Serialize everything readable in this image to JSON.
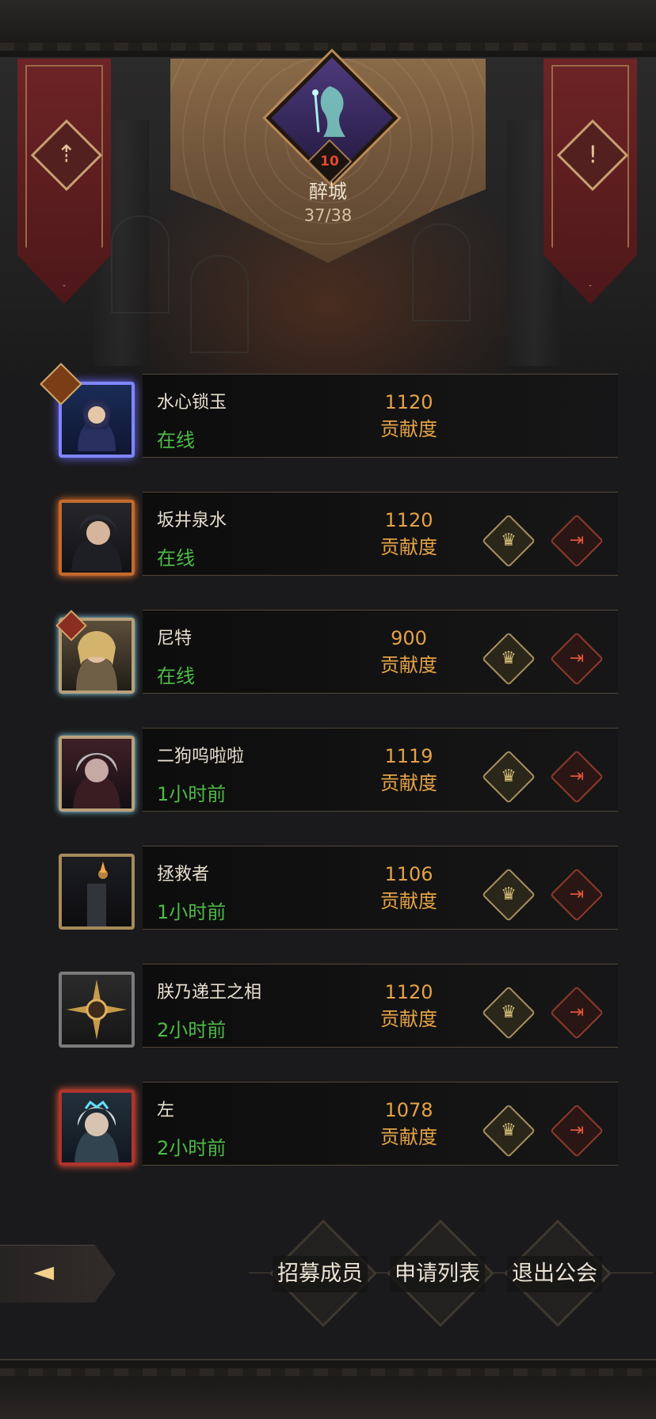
{
  "guild": {
    "level": "10",
    "name": "醉城",
    "members_count": "37/38"
  },
  "members": [
    {
      "name": "水心锁玉",
      "status": "在线",
      "contribution": "1120",
      "contribution_label": "贡献度",
      "can_manage": false
    },
    {
      "name": "坂井泉水",
      "status": "在线",
      "contribution": "1120",
      "contribution_label": "贡献度",
      "can_manage": true
    },
    {
      "name": "尼特",
      "status": "在线",
      "contribution": "900",
      "contribution_label": "贡献度",
      "can_manage": true
    },
    {
      "name": "二狗呜啦啦",
      "status": "1小时前",
      "contribution": "1119",
      "contribution_label": "贡献度",
      "can_manage": true
    },
    {
      "name": "拯救者",
      "status": "1小时前",
      "contribution": "1106",
      "contribution_label": "贡献度",
      "can_manage": true
    },
    {
      "name": "朕乃递王之相",
      "status": "2小时前",
      "contribution": "1120",
      "contribution_label": "贡献度",
      "can_manage": true
    },
    {
      "name": "左",
      "status": "2小时前",
      "contribution": "1078",
      "contribution_label": "贡献度",
      "can_manage": true
    }
  ],
  "actions": {
    "recruit": "招募成员",
    "applications": "申请列表",
    "leave": "退出公会"
  },
  "icons": {
    "left_banner": "upgrade-arrow-icon",
    "right_banner": "info-icon",
    "promote": "crown-transfer-icon",
    "kick": "kick-member-icon",
    "back": "back-arrow-icon"
  },
  "colors": {
    "online": "#4dba47",
    "contribution": "#e3a246",
    "banner": "#6e2426",
    "crest": "#8a6a48"
  }
}
